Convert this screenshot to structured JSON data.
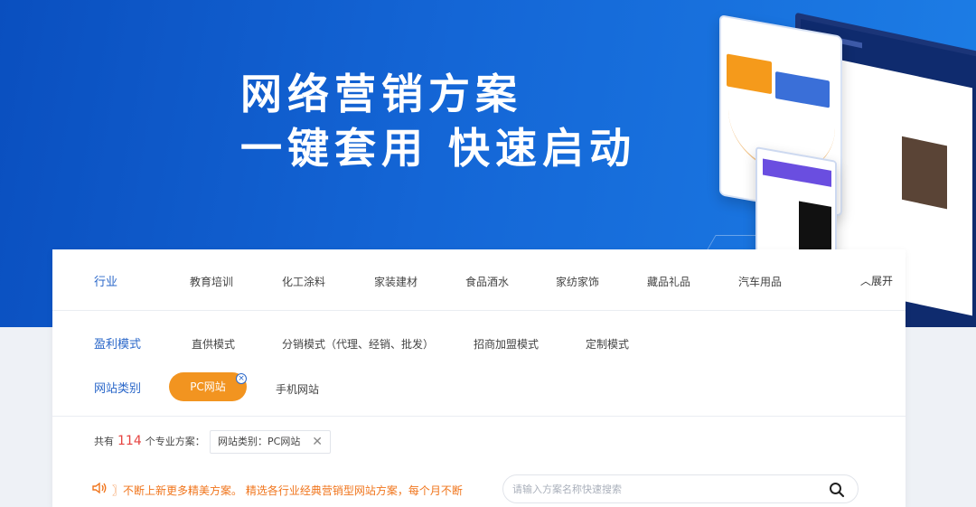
{
  "hero": {
    "line1": "网络营销方案",
    "line2": "一键套用 快速启动"
  },
  "filters": {
    "industry": {
      "label": "行业",
      "items": [
        "教育培训",
        "化工涂料",
        "家装建材",
        "食品酒水",
        "家纺家饰",
        "藏品礼品",
        "汽车用品"
      ],
      "expand": "展开"
    },
    "profit_model": {
      "label": "盈利模式",
      "items": [
        "直供模式",
        "分销模式（代理、经销、批发）",
        "招商加盟模式",
        "定制模式"
      ]
    },
    "site_type": {
      "label": "网站类别",
      "items": [
        "PC网站",
        "手机网站"
      ],
      "selected": "PC网站"
    }
  },
  "results": {
    "prefix": "共有",
    "count": "114",
    "suffix": "个专业方案：",
    "active_filter": "网站类别：PC网站"
  },
  "notice": {
    "text": "〗不断上新更多精美方案。  精选各行业经典营销型网站方案，每个月不断"
  },
  "search": {
    "placeholder": "请输入方案名称快速搜索"
  },
  "colors": {
    "hero_blue": "#1466d6",
    "accent_orange": "#f29420",
    "label_blue": "#2a67c9",
    "count_red": "#e64340"
  }
}
